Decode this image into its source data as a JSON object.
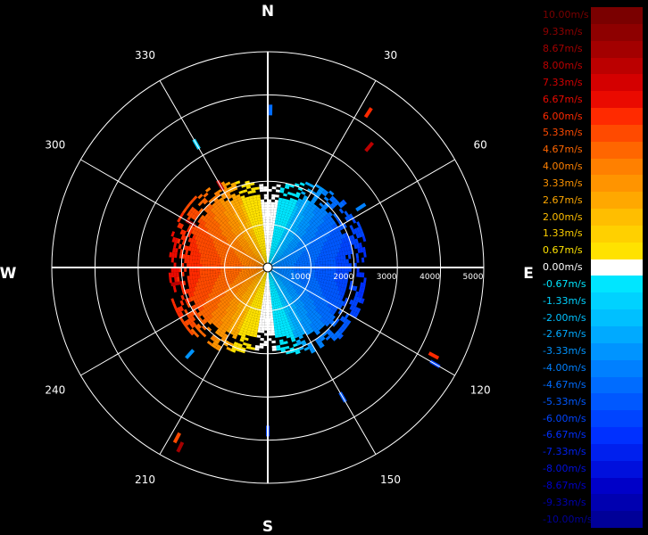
{
  "chart_data": {
    "type": "polar-radial-velocity",
    "title": "",
    "cardinal_labels": {
      "north": "N",
      "east": "E",
      "south": "S",
      "west": "W"
    },
    "angle_labels": [
      "30",
      "60",
      "120",
      "150",
      "210",
      "240",
      "300",
      "330"
    ],
    "angle_values_deg": [
      30,
      60,
      120,
      150,
      210,
      240,
      300,
      330
    ],
    "range_ticks": [
      1000,
      2000,
      3000,
      4000,
      5000
    ],
    "range_tick_labels": [
      "1000",
      "2000",
      "3000",
      "4000",
      "5000"
    ],
    "range_max": 5000,
    "spoke_angles_deg": [
      0,
      30,
      60,
      90,
      120,
      150,
      180,
      210,
      240,
      270,
      300,
      330
    ],
    "grid": true,
    "colorbar": {
      "unit": "m/s",
      "labels": [
        "10.00m/s",
        "9.33m/s",
        "8.67m/s",
        "8.00m/s",
        "7.33m/s",
        "6.67m/s",
        "6.00m/s",
        "5.33m/s",
        "4.67m/s",
        "4.00m/s",
        "3.33m/s",
        "2.67m/s",
        "2.00m/s",
        "1.33m/s",
        "0.67m/s",
        "0.00m/s",
        "-0.67m/s",
        "-1.33m/s",
        "-2.00m/s",
        "-2.67m/s",
        "-3.33m/s",
        "-4.00m/s",
        "-4.67m/s",
        "-5.33m/s",
        "-6.00m/s",
        "-6.67m/s",
        "-7.33m/s",
        "-8.00m/s",
        "-8.67m/s",
        "-9.33m/s",
        "-10.00m/s"
      ],
      "values": [
        10.0,
        9.33,
        8.67,
        8.0,
        7.33,
        6.67,
        6.0,
        5.33,
        4.67,
        4.0,
        3.33,
        2.67,
        2.0,
        1.33,
        0.67,
        0.0,
        -0.67,
        -1.33,
        -2.0,
        -2.67,
        -3.33,
        -4.0,
        -4.67,
        -5.33,
        -6.0,
        -6.67,
        -7.33,
        -8.0,
        -8.67,
        -9.33,
        -10.0
      ],
      "colors": [
        "#7a0000",
        "#8e0000",
        "#a30000",
        "#bb0000",
        "#d40000",
        "#ea0a00",
        "#ff2a00",
        "#ff4a00",
        "#ff6600",
        "#ff8000",
        "#ff9400",
        "#ffa800",
        "#ffbe00",
        "#ffd000",
        "#ffe200",
        "#ffffff",
        "#00e6ff",
        "#00d2ff",
        "#00c0ff",
        "#00aaff",
        "#0094ff",
        "#0080ff",
        "#006cff",
        "#0058ff",
        "#0044ff",
        "#0030ff",
        "#0020ee",
        "#0010dd",
        "#0000c8",
        "#0000b0",
        "#000098"
      ]
    }
  }
}
